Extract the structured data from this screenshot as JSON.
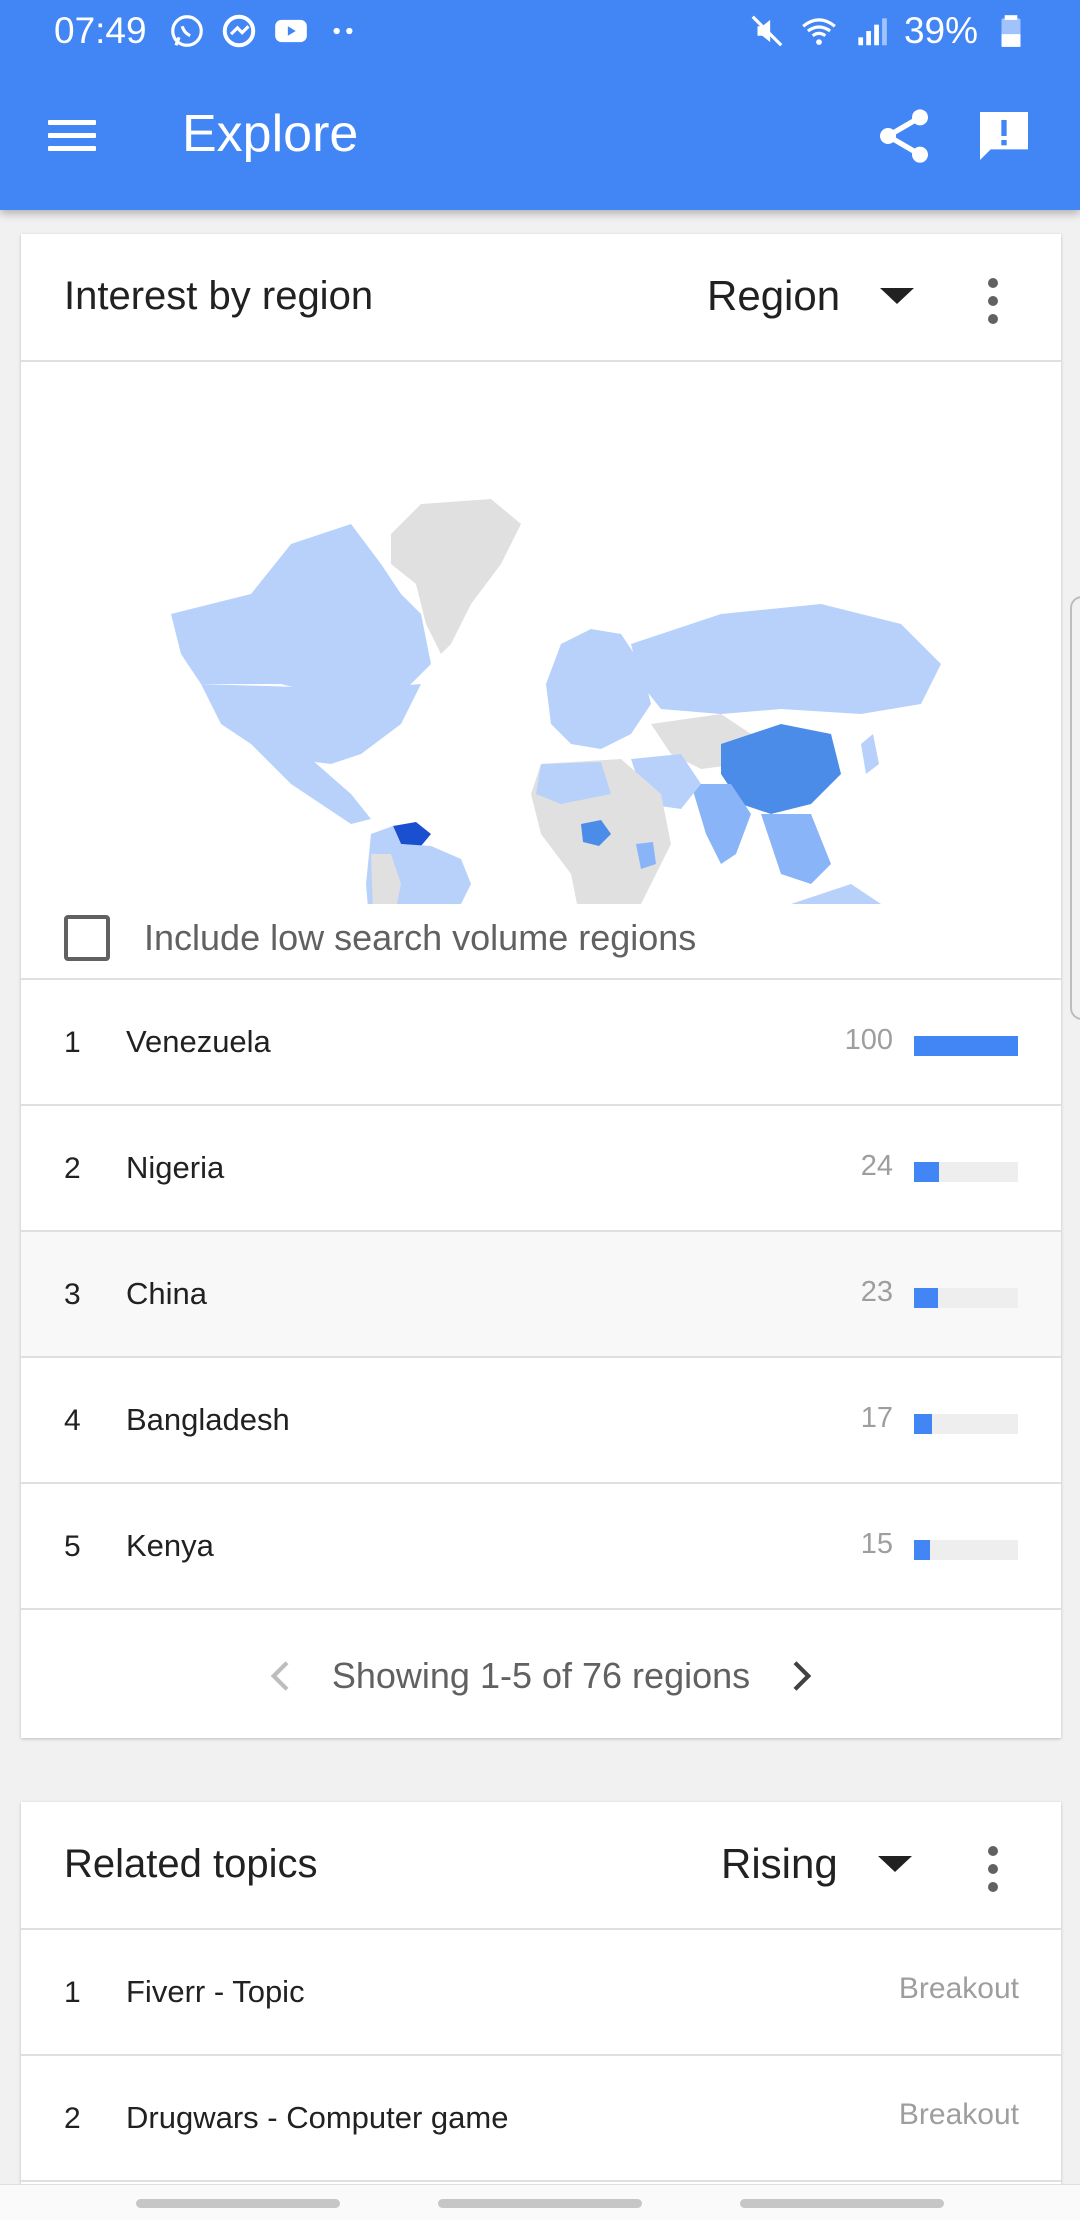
{
  "status_bar": {
    "time": "07:49",
    "battery": "39%",
    "left_icons": [
      "whatsapp-icon",
      "messenger-icon",
      "youtube-icon",
      "more-dots-icon"
    ],
    "right_icons": [
      "mute-icon",
      "wifi-icon",
      "signal-icon",
      "battery-icon"
    ]
  },
  "toolbar": {
    "title": "Explore",
    "menu_icon": "menu-icon",
    "share_icon": "share-icon",
    "feedback_icon": "feedback-icon"
  },
  "colors": {
    "primary": "#4285f4",
    "map_top": "#1a4fd0",
    "map_high": "#4a8ce8",
    "map_mid": "#8ab4f8",
    "map_low": "#b7d1fb",
    "map_none": "#e0e0e0"
  },
  "interest_by_region": {
    "title": "Interest by region",
    "dropdown": "Region",
    "include_low_volume_label": "Include low search volume regions",
    "include_low_volume_checked": false,
    "rows": [
      {
        "rank": "1",
        "name": "Venezuela",
        "value": "100",
        "fraction": 1.0
      },
      {
        "rank": "2",
        "name": "Nigeria",
        "value": "24",
        "fraction": 0.24
      },
      {
        "rank": "3",
        "name": "China",
        "value": "23",
        "fraction": 0.23
      },
      {
        "rank": "4",
        "name": "Bangladesh",
        "value": "17",
        "fraction": 0.17
      },
      {
        "rank": "5",
        "name": "Kenya",
        "value": "15",
        "fraction": 0.15
      }
    ],
    "pager_text": "Showing 1-5 of 76 regions"
  },
  "related_topics": {
    "title": "Related topics",
    "dropdown": "Rising",
    "rows": [
      {
        "rank": "1",
        "name": "Fiverr - Topic",
        "value": "Breakout"
      },
      {
        "rank": "2",
        "name": "Drugwars - Computer game",
        "value": "Breakout"
      }
    ]
  }
}
